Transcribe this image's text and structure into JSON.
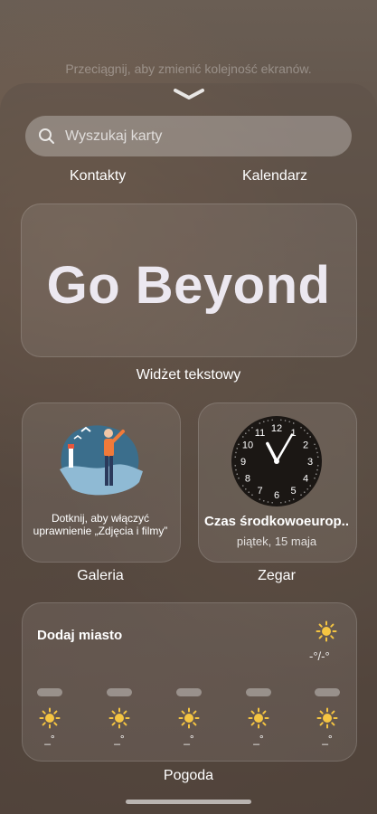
{
  "hint": "Przeciągnij, aby zmienić kolejność ekranów.",
  "search": {
    "placeholder": "Wyszukaj karty"
  },
  "tabs": [
    "Kontakty",
    "Kalendarz"
  ],
  "text_widget": {
    "text": "Go Beyond",
    "caption": "Widżet tekstowy"
  },
  "gallery": {
    "message": "Dotknij, aby włączyć uprawnienie „Zdjęcia i filmy”",
    "caption": "Galeria"
  },
  "clock": {
    "timezone": "Czas środkowoeurop..",
    "date": "piątek, 15 maja",
    "caption": "Zegar",
    "numbers": [
      "12",
      "1",
      "2",
      "3",
      "4",
      "5",
      "6",
      "7",
      "8",
      "9",
      "10",
      "11"
    ],
    "time": {
      "hour": 11,
      "minute": 5
    }
  },
  "weather": {
    "city": "Dodaj miasto",
    "range": "-°/-°",
    "days": [
      {
        "temp": "_°"
      },
      {
        "temp": "_°"
      },
      {
        "temp": "_°"
      },
      {
        "temp": "_°"
      },
      {
        "temp": "_°"
      }
    ],
    "caption": "Pogoda",
    "icon": "sun-icon",
    "sun_color": "#f5c542"
  }
}
